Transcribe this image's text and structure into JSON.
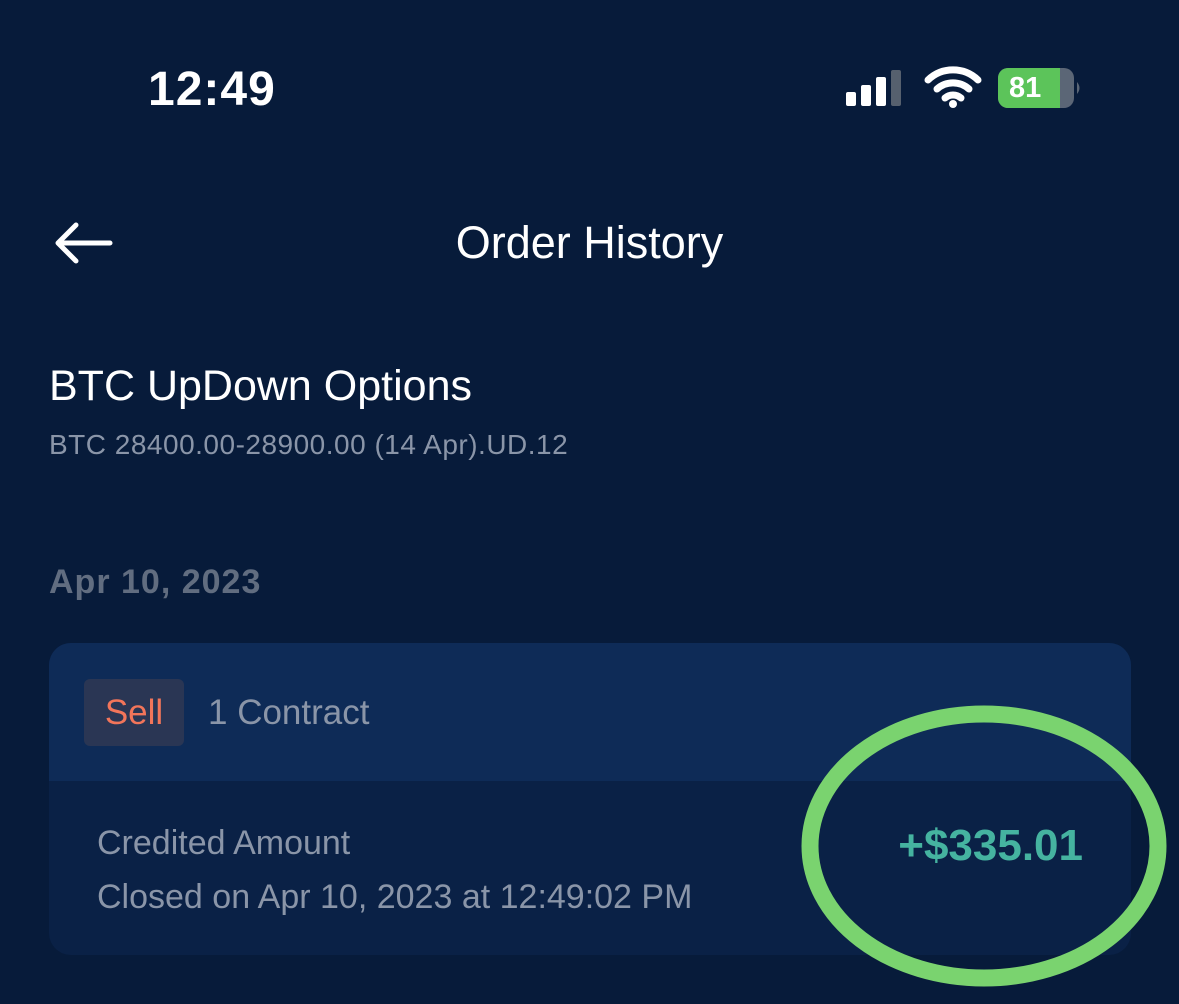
{
  "status_bar": {
    "time": "12:49",
    "battery_level": "81",
    "signal_icon": "cellular-signal-icon",
    "wifi_icon": "wifi-icon",
    "battery_icon": "battery-charging-icon"
  },
  "nav": {
    "back_icon": "arrow-left-icon",
    "title": "Order History"
  },
  "product": {
    "title": "BTC UpDown Options",
    "subtitle": "BTC 28400.00-28900.00 (14 Apr).UD.12"
  },
  "orders": [
    {
      "date": "Apr 10, 2023",
      "side": "Sell",
      "quantity": "1 Contract",
      "amount_label": "Credited Amount",
      "closed_text": "Closed on Apr 10, 2023 at 12:49:02 PM",
      "amount": "+$335.01"
    }
  ],
  "colors": {
    "background": "#071b3a",
    "card": "#0a2146",
    "card_header": "#0e2b57",
    "sell": "#f2755a",
    "positive": "#45b3a0",
    "highlight": "#7ad36f"
  }
}
